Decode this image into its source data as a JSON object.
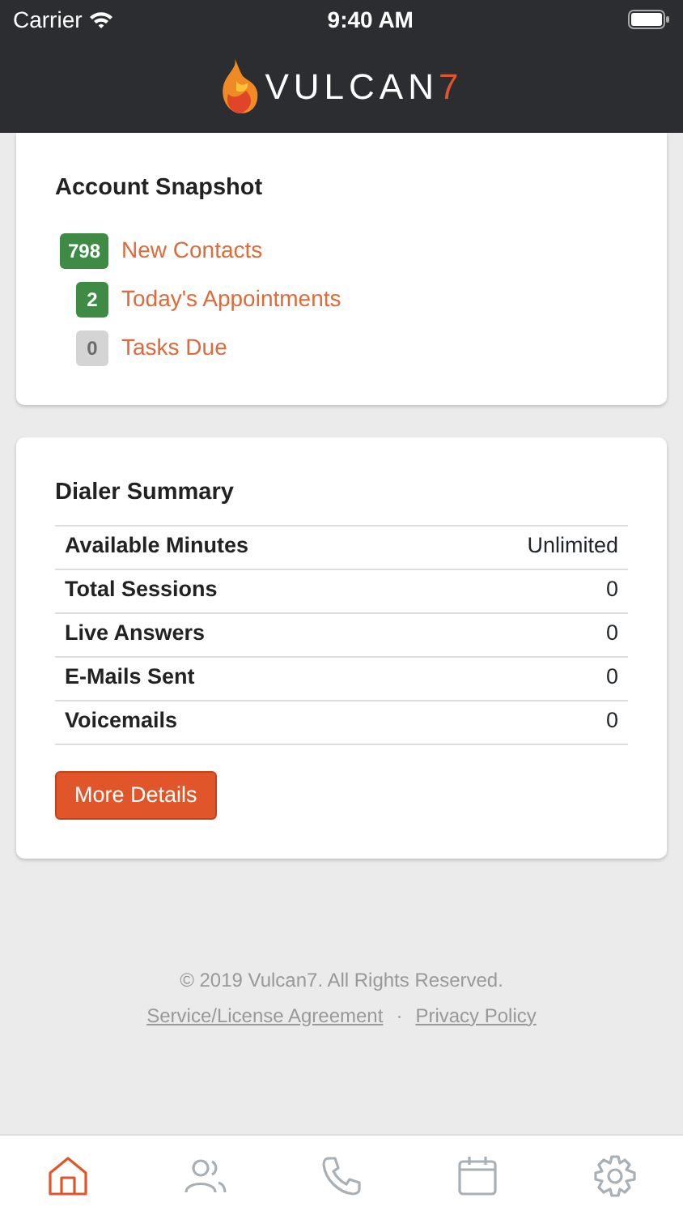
{
  "status_bar": {
    "carrier": "Carrier",
    "time": "9:40 AM"
  },
  "header": {
    "logo_text": "VULCAN",
    "logo_accent": "7"
  },
  "account_snapshot": {
    "title": "Account Snapshot",
    "items": [
      {
        "count": "798",
        "label": "New Contacts",
        "color": "#3d8b45"
      },
      {
        "count": "2",
        "label": "Today's Appointments",
        "color": "#3d8b45"
      },
      {
        "count": "0",
        "label": "Tasks Due",
        "color": "#d4d4d4"
      }
    ]
  },
  "dialer_summary": {
    "title": "Dialer Summary",
    "rows": [
      {
        "label": "Available Minutes",
        "value": "Unlimited"
      },
      {
        "label": "Total Sessions",
        "value": "0"
      },
      {
        "label": "Live Answers",
        "value": "0"
      },
      {
        "label": "E-Mails Sent",
        "value": "0"
      },
      {
        "label": "Voicemails",
        "value": "0"
      }
    ],
    "button": "More Details"
  },
  "footer": {
    "copyright": "© 2019 Vulcan7. All Rights Reserved.",
    "links": [
      "Service/License Agreement",
      "Privacy Policy"
    ],
    "separator": "·"
  },
  "tab_bar": [
    {
      "kind": "home",
      "selected": true
    },
    {
      "kind": "contacts",
      "selected": false
    },
    {
      "kind": "phone",
      "selected": false
    },
    {
      "kind": "calendar",
      "selected": false
    },
    {
      "kind": "settings",
      "selected": false
    }
  ]
}
